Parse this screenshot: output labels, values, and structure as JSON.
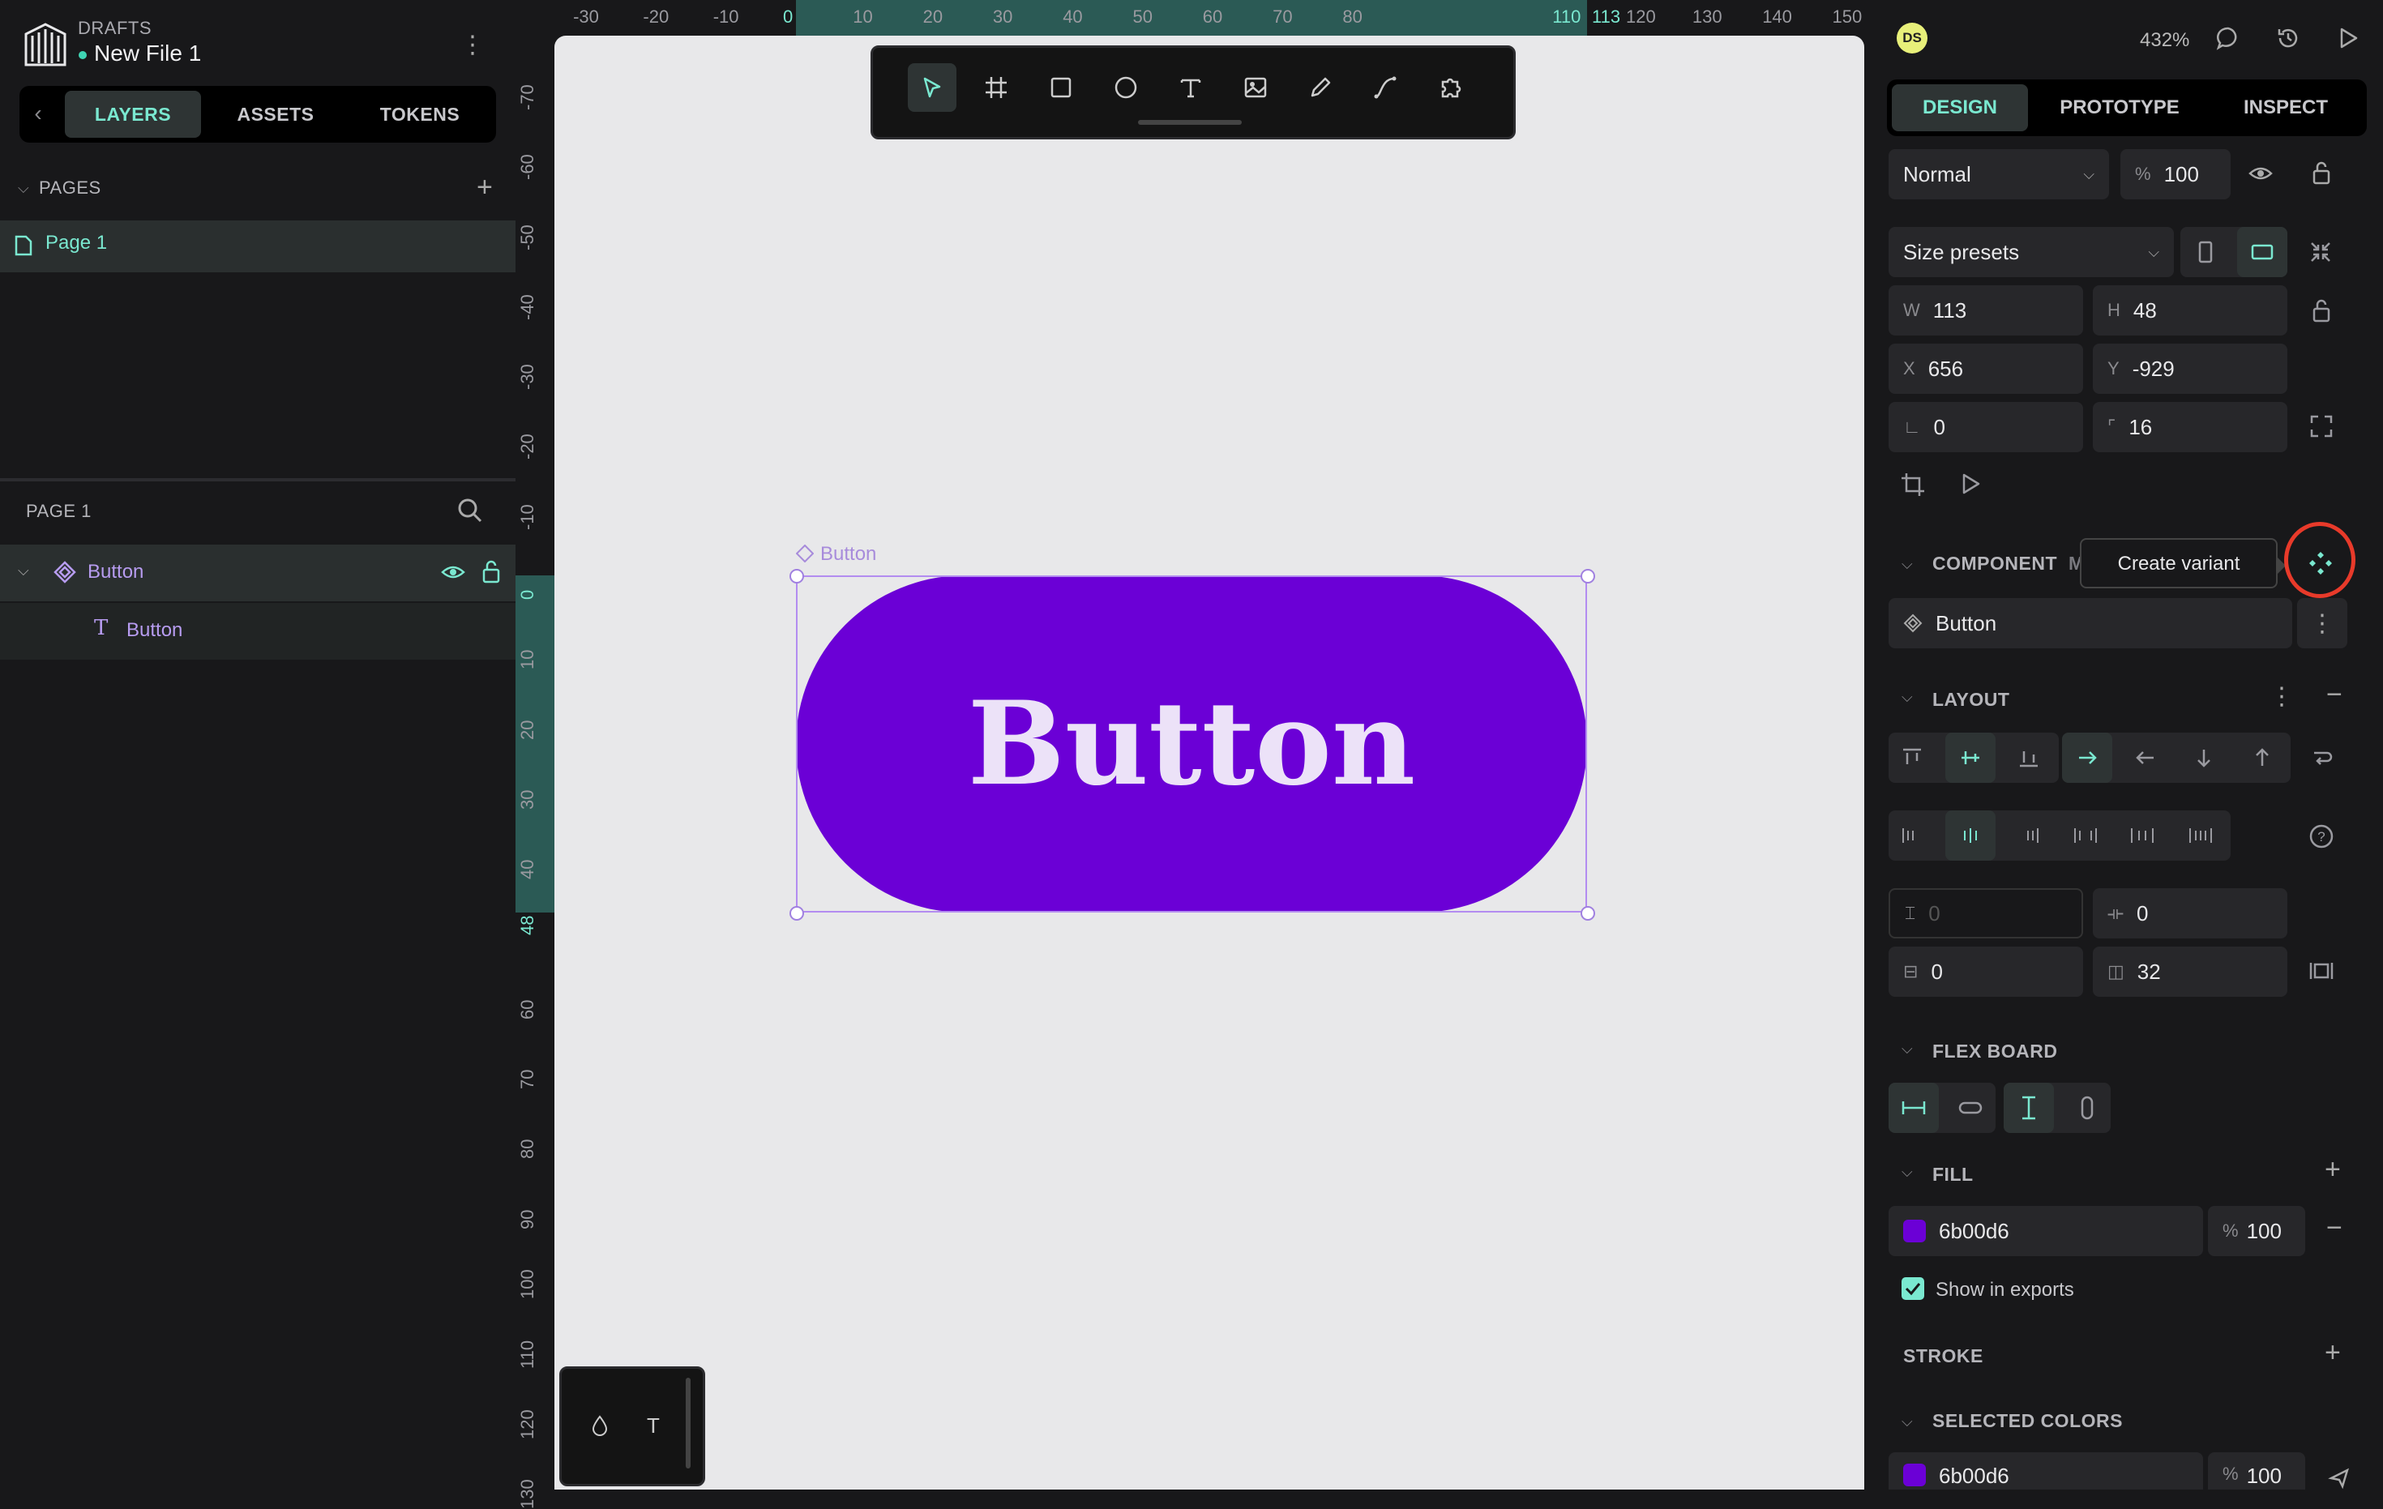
{
  "header": {
    "project": "DRAFTS",
    "file_name": "New File 1"
  },
  "left_tabs": [
    "LAYERS",
    "ASSETS",
    "TOKENS"
  ],
  "pages": {
    "title": "PAGES",
    "items": [
      {
        "label": "Page 1"
      }
    ]
  },
  "layers": {
    "title": "PAGE 1",
    "items": [
      {
        "label": "Button",
        "type": "component"
      },
      {
        "label": "Button",
        "type": "text"
      }
    ]
  },
  "ruler_top": [
    "-30",
    "-20",
    "-10",
    "0",
    "10",
    "20",
    "30",
    "40",
    "50",
    "60",
    "70",
    "80",
    "110",
    "113",
    "120",
    "130",
    "140",
    "150"
  ],
  "ruler_left": [
    "-70",
    "-60",
    "-50",
    "-40",
    "-30",
    "-20",
    "-10",
    "0",
    "10",
    "20",
    "30",
    "40",
    "48",
    "60",
    "70",
    "80",
    "90",
    "100",
    "110",
    "120",
    "130"
  ],
  "canvas": {
    "component_label": "Button",
    "button_text": "Button",
    "button_color": "#6b00d6"
  },
  "toolbar": [
    "pointer",
    "board",
    "rectangle",
    "ellipse",
    "text",
    "image",
    "pencil",
    "path",
    "plugins"
  ],
  "right": {
    "avatar": "DS",
    "zoom": "432%",
    "tabs": [
      "DESIGN",
      "PROTOTYPE",
      "INSPECT"
    ],
    "blend_mode": "Normal",
    "opacity": "100",
    "opacity_unit": "%",
    "size_presets": "Size presets",
    "w_label": "W",
    "w": "113",
    "h_label": "H",
    "h": "48",
    "x_label": "X",
    "x": "656",
    "y_label": "Y",
    "y": "-929",
    "rotation": "0",
    "radius": "16",
    "component_section": "COMPONENT",
    "component_section_suffix": "M",
    "tooltip": "Create variant",
    "component_name": "Button",
    "layout_section": "LAYOUT",
    "padding_v": "0",
    "gap_col": "0",
    "padding_top": "0",
    "padding_h": "32",
    "flex_board_section": "FLEX BOARD",
    "fill_section": "FILL",
    "fill_hex": "6b00d6",
    "fill_opacity": "100",
    "show_in_exports": "Show in exports",
    "stroke_section": "STROKE",
    "selected_colors_section": "SELECTED COLORS",
    "selected_color_hex": "6b00d6",
    "selected_color_opacity": "100"
  },
  "colors": {
    "accent": "#7ae8d0",
    "component_purple": "#b79cf0",
    "annotation": "#e83a2a"
  }
}
